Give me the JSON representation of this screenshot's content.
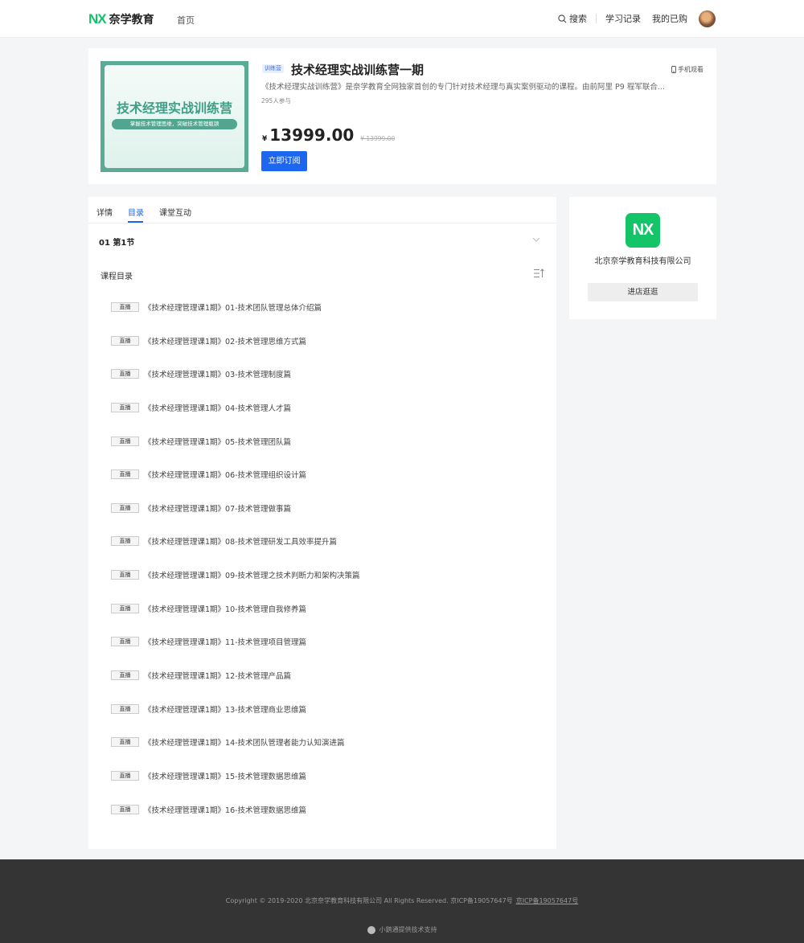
{
  "header": {
    "logo_mark": "NX",
    "logo_text": "奈学教育",
    "nav_home": "首页",
    "search_label": "搜索",
    "study_record": "学习记录",
    "purchased": "我的已购"
  },
  "product": {
    "tag": "训练营",
    "title": "技术经理实战训练营一期",
    "mobile_watch": "手机观看",
    "description": "《技术经理实战训练营》是奈学教育全网独家首创的专门针对技术经理与真实案例驱动的课程。由前阿里 P9 程军联合...",
    "joined": "295人参与",
    "currency": "¥",
    "price": "13999.00",
    "original_price": "¥ 13999.00",
    "buy_label": "立即订阅",
    "cover_title": "技术经理实战训练营",
    "cover_subtitle": "掌握技术管理思维，突破技术管理瓶颈"
  },
  "tabs": [
    "详情",
    "目录",
    "课堂互动"
  ],
  "active_tab": "目录",
  "section": {
    "title": "01 第1节",
    "catalog_label": "课程目录"
  },
  "lessons": [
    {
      "tag": "直播",
      "title": "《技术经理管理课1期》01-技术团队管理总体介绍篇"
    },
    {
      "tag": "直播",
      "title": "《技术经理管理课1期》02-技术管理思维方式篇"
    },
    {
      "tag": "直播",
      "title": "《技术经理管理课1期》03-技术管理制度篇"
    },
    {
      "tag": "直播",
      "title": "《技术经理管理课1期》04-技术管理人才篇"
    },
    {
      "tag": "直播",
      "title": "《技术经理管理课1期》05-技术管理团队篇"
    },
    {
      "tag": "直播",
      "title": "《技术经理管理课1期》06-技术管理组织设计篇"
    },
    {
      "tag": "直播",
      "title": "《技术经理管理课1期》07-技术管理做事篇"
    },
    {
      "tag": "直播",
      "title": "《技术经理管理课1期》08-技术管理研发工具效率提升篇"
    },
    {
      "tag": "直播",
      "title": "《技术经理管理课1期》09-技术管理之技术判断力和架构决策篇"
    },
    {
      "tag": "直播",
      "title": "《技术经理管理课1期》10-技术管理自我修养篇"
    },
    {
      "tag": "直播",
      "title": "《技术经理管理课1期》11-技术管理项目管理篇"
    },
    {
      "tag": "直播",
      "title": "《技术经理管理课1期》12-技术管理产品篇"
    },
    {
      "tag": "直播",
      "title": "《技术经理管理课1期》13-技术管理商业思维篇"
    },
    {
      "tag": "直播",
      "title": "《技术经理管理课1期》14-技术团队管理者能力认知演进篇"
    },
    {
      "tag": "直播",
      "title": "《技术经理管理课1期》15-技术管理数据思维篇"
    },
    {
      "tag": "直播",
      "title": "《技术经理管理课1期》16-技术管理数据思维篇"
    }
  ],
  "side": {
    "logo_mark": "NX",
    "company": "北京奈学教育科技有限公司",
    "shop_label": "进店逛逛"
  },
  "footer": {
    "copyright": "Copyright © 2019-2020 北京奈学教育科技有限公司 All Rights Reserved. 京ICP备19057647号",
    "icp_link": "京ICP备19057647号",
    "powered": "小鹅通提供技术支持"
  },
  "colors": {
    "brand_green": "#13c26b",
    "primary_blue": "#1d66f0",
    "footer_bg": "#343434"
  }
}
